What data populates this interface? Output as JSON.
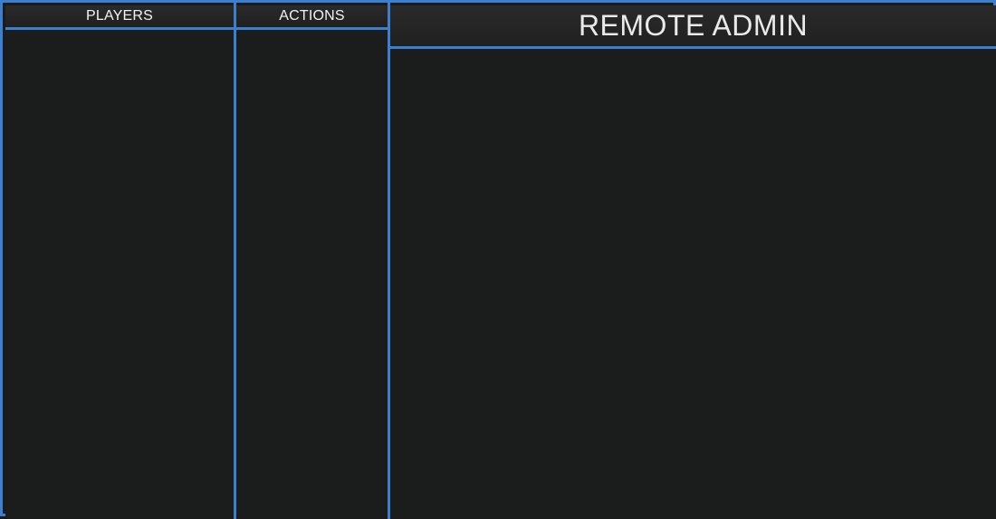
{
  "players_panel": {
    "title": "PLAYERS",
    "items": []
  },
  "actions_panel": {
    "title": "ACTIONS",
    "items": []
  },
  "main_panel": {
    "title": "REMOTE ADMIN"
  },
  "colors": {
    "accent_border": "#3a7fd0",
    "background": "#1b1c1c",
    "header_background": "#242424",
    "text": "#f2f2f2"
  }
}
